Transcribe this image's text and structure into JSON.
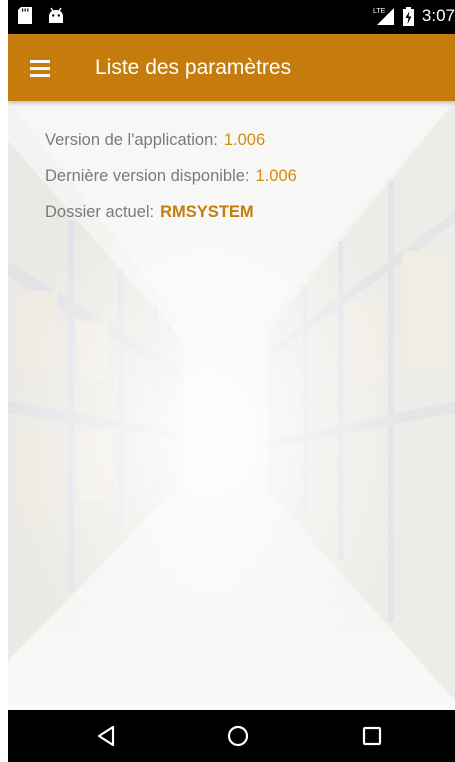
{
  "status_bar": {
    "time": "3:07",
    "network": "LTE",
    "icons": [
      "sd-card-icon",
      "android-icon",
      "lte-signal-icon",
      "battery-charging-icon"
    ]
  },
  "app_bar": {
    "title": "Liste des paramètres",
    "menu_icon": "hamburger-menu-icon",
    "color": "#c67c0c"
  },
  "settings": {
    "app_version_label": "Version de l'application:",
    "app_version_value": "1.006",
    "latest_version_label": "Dernière version disponible:",
    "latest_version_value": "1.006",
    "current_folder_label": "Dossier actuel:",
    "current_folder_value": "RMSYSTEM"
  },
  "colors": {
    "accent": "#c67c0c",
    "value_text": "#d88a12",
    "label_text": "#7a7a7a"
  },
  "nav_bar": {
    "icons": [
      "back-icon",
      "home-icon",
      "recents-icon"
    ]
  }
}
